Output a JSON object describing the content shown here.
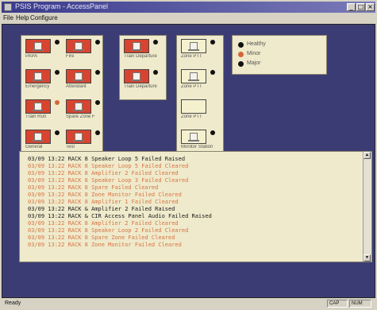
{
  "window": {
    "title": "PSIS Program - AccessPanel",
    "buttons": [
      "_",
      "□",
      "×"
    ]
  },
  "menu": [
    {
      "label": "File"
    },
    {
      "label": "Help"
    },
    {
      "label": "Configure"
    }
  ],
  "panels": {
    "group1": {
      "tiles": [
        {
          "label": "PAPA",
          "style": "red",
          "status": "black"
        },
        {
          "label": "Fire",
          "style": "red",
          "status": "black"
        },
        {
          "label": "Emergency",
          "style": "red",
          "status": "black"
        },
        {
          "label": "Attendant",
          "style": "red",
          "status": "black"
        },
        {
          "label": "Train Run",
          "style": "red",
          "status": "orange"
        },
        {
          "label": "Spare Zone F",
          "style": "red",
          "status": "black"
        },
        {
          "label": "General",
          "style": "red",
          "status": "black"
        },
        {
          "label": "Test",
          "style": "red",
          "status": "black"
        }
      ]
    },
    "group2": {
      "tiles": [
        {
          "label": "Train Departure",
          "style": "red",
          "status": "black"
        },
        {
          "label": "Train Departure",
          "style": "red",
          "status": "black"
        }
      ]
    },
    "group3": {
      "tiles": [
        {
          "label": "Zone PTT",
          "style": "light",
          "status": "black"
        },
        {
          "label": "Zone PTT",
          "style": "light",
          "status": "black"
        },
        {
          "label": "Zone PTT",
          "style": "light",
          "status": "none"
        },
        {
          "label": "Monitor Station",
          "style": "light",
          "status": "black"
        }
      ]
    }
  },
  "legend": [
    {
      "label": "Healthy",
      "color": "black"
    },
    {
      "label": "Minor",
      "color": "orange"
    },
    {
      "label": "Major",
      "color": "black"
    }
  ],
  "log": [
    {
      "text": "03/09 13:22 RACK 8 Speaker Loop 5 Failed Raised",
      "type": "normal"
    },
    {
      "text": "03/09 13:22 RACK 8 Speaker Loop 5 Failed Cleared",
      "type": "alert"
    },
    {
      "text": "03/09 13:22 RACK 8 Amplifier 2 Failed Cleared",
      "type": "alert"
    },
    {
      "text": "03/09 13:22 RACK 8 Speaker Loop 3 Failed Cleared",
      "type": "alert"
    },
    {
      "text": "03/09 13:22 RACK 8 Spare Failed Cleared",
      "type": "alert"
    },
    {
      "text": "03/09 13:22 RACK 8 Zone Monitor Failed Cleared",
      "type": "alert"
    },
    {
      "text": "03/09 13:22 RACK 8 Amplifier 1 Failed Cleared",
      "type": "alert"
    },
    {
      "text": "03/09 13:22 RACK & Amplifier 2 Failed Raised",
      "type": "normal"
    },
    {
      "text": "03/09 13:22 RACK & CIR Access Panel Audio Failed Raised",
      "type": "normal"
    },
    {
      "text": "03/09 13:22 RACK 8 Amplifier 2 Failed Cleared",
      "type": "alert"
    },
    {
      "text": "03/09 13:22 RACK 8 Speaker Loop 2 Failed Cleared",
      "type": "alert"
    },
    {
      "text": "03/09 13:22 RACK 8 Spare Zone Failed Cleared",
      "type": "alert"
    },
    {
      "text": "03/09 13:22 RACK 8 Zone Monitor Failed Cleared",
      "type": "alert"
    }
  ],
  "status": {
    "left": "Ready",
    "cells": [
      "CAP",
      "NUM"
    ]
  },
  "colors": {
    "titlebar": "#3a3a8c",
    "client_bg": "#3c3c74",
    "panel_bg": "#efeacb",
    "tile_red": "#d8442f",
    "alert_text": "#d67545"
  }
}
